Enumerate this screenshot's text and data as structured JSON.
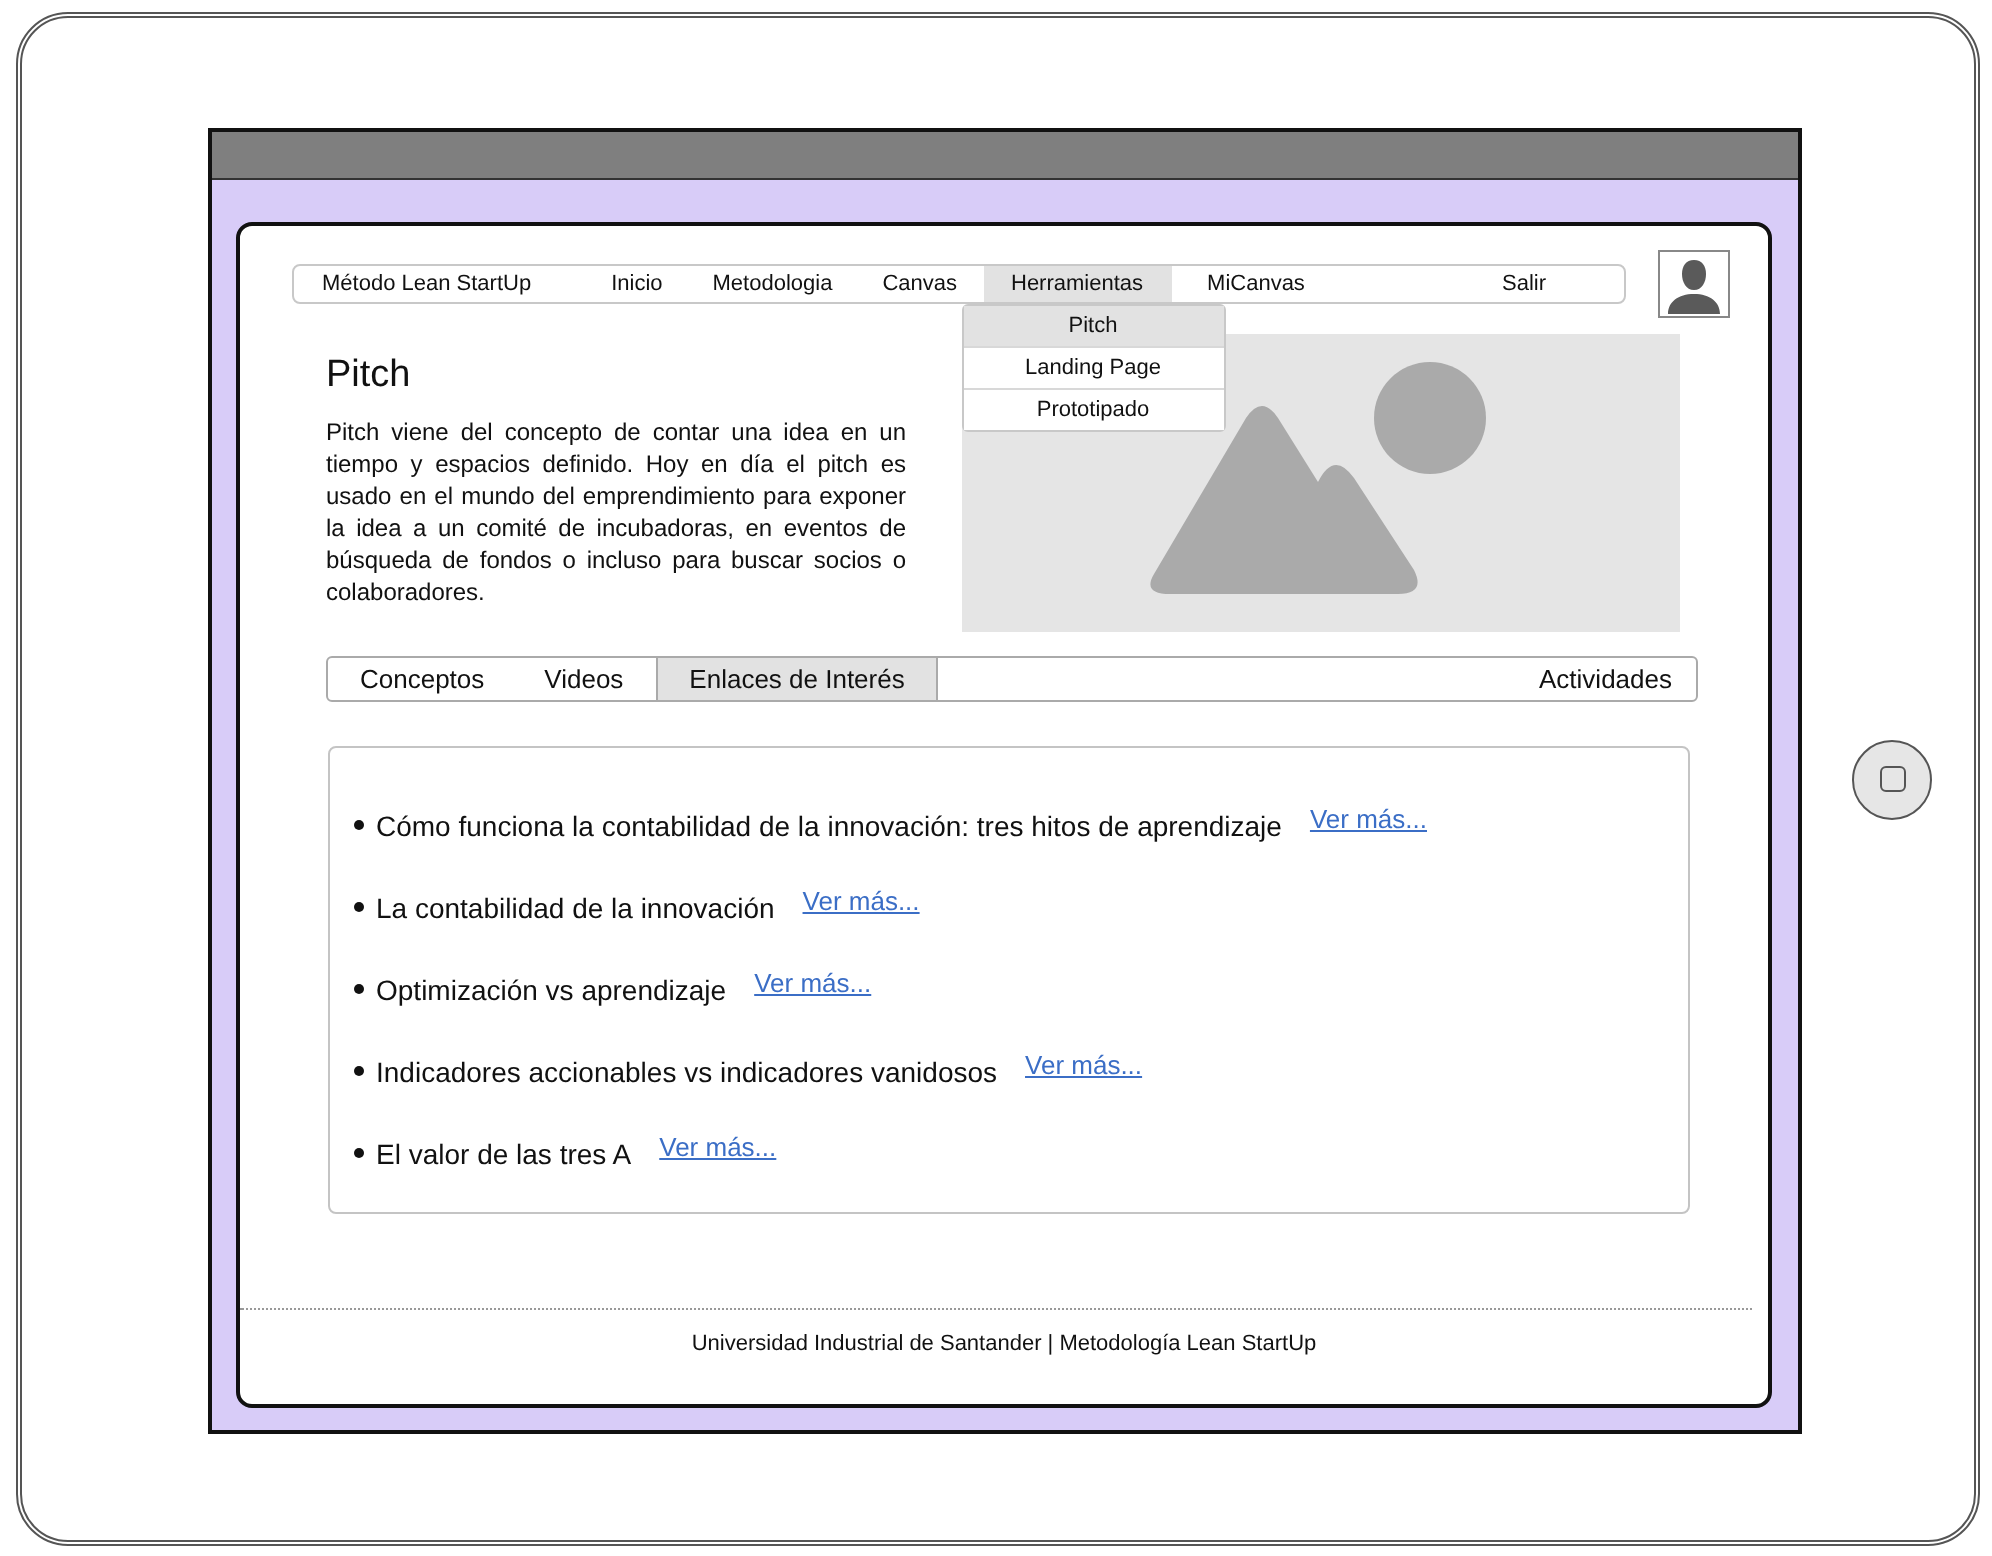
{
  "nav": {
    "items": [
      {
        "label": "Método Lean StartUp",
        "selected": false
      },
      {
        "label": "Inicio",
        "selected": false
      },
      {
        "label": "Metodologia",
        "selected": false
      },
      {
        "label": "Canvas",
        "selected": false
      },
      {
        "label": "Herramientas",
        "selected": true,
        "menu": [
          {
            "label": "Pitch",
            "selected": true
          },
          {
            "label": "Landing Page",
            "selected": false
          },
          {
            "label": "Prototipado",
            "selected": false
          }
        ]
      },
      {
        "label": "MiCanvas",
        "selected": false
      },
      {
        "label": "Salir",
        "selected": false
      }
    ]
  },
  "page": {
    "title": "Pitch",
    "description": "Pitch viene del concepto de contar una idea en un tiempo y espacios definido. Hoy en día el pitch es usado en el mundo del emprendimiento para exponer la idea a un comité de incubadoras, en eventos de búsqueda de fondos o incluso para buscar socios o colaboradores."
  },
  "tabs": [
    {
      "label": "Conceptos",
      "selected": false
    },
    {
      "label": "Videos",
      "selected": false
    },
    {
      "label": "Enlaces de Interés",
      "selected": true
    }
  ],
  "end_tab": {
    "label": "Actividades",
    "selected": false
  },
  "links": [
    {
      "text": "Cómo funciona la contabilidad de la innovación: tres hitos de aprendizaje",
      "link": "Ver más..."
    },
    {
      "text": "La contabilidad de la innovación",
      "link": "Ver más..."
    },
    {
      "text": "Optimización vs aprendizaje",
      "link": "Ver más..."
    },
    {
      "text": "Indicadores accionables vs indicadores vanidosos",
      "link": "Ver más..."
    },
    {
      "text": "El valor de las tres A",
      "link": "Ver más..."
    }
  ],
  "footer": "Universidad Industrial de Santander | Metodología Lean StartUp"
}
